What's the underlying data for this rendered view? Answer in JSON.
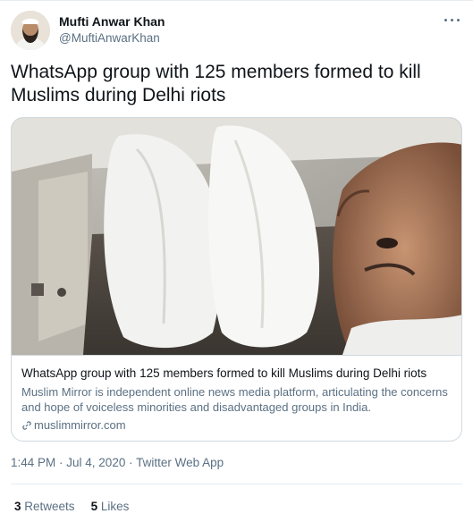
{
  "author": {
    "name": "Mufti Anwar Khan",
    "handle": "@MuftiAnwarKhan"
  },
  "tweet": {
    "text": "WhatsApp group with 125 members formed to kill Muslims during Delhi riots"
  },
  "card": {
    "title": "WhatsApp group with 125 members formed to kill Muslims during Delhi riots",
    "description": "Muslim Mirror is independent online news media platform, articulating the concerns and hope of voiceless minorities and disadvantaged groups in India.",
    "domain": "muslimmirror.com",
    "link_icon": "link-icon",
    "image_icon": "photo-thumbnail"
  },
  "meta": {
    "time": "1:44 PM",
    "sep1": " · ",
    "date": "Jul 4, 2020",
    "sep2": " · ",
    "source": "Twitter Web App"
  },
  "stats": {
    "retweets_count": "3",
    "retweets_label": "Retweets",
    "likes_count": "5",
    "likes_label": "Likes"
  },
  "colors": {
    "text_primary": "#0f1419",
    "text_secondary": "#5b7083",
    "border": "#cfd9de",
    "divider": "#e6ecf0"
  }
}
